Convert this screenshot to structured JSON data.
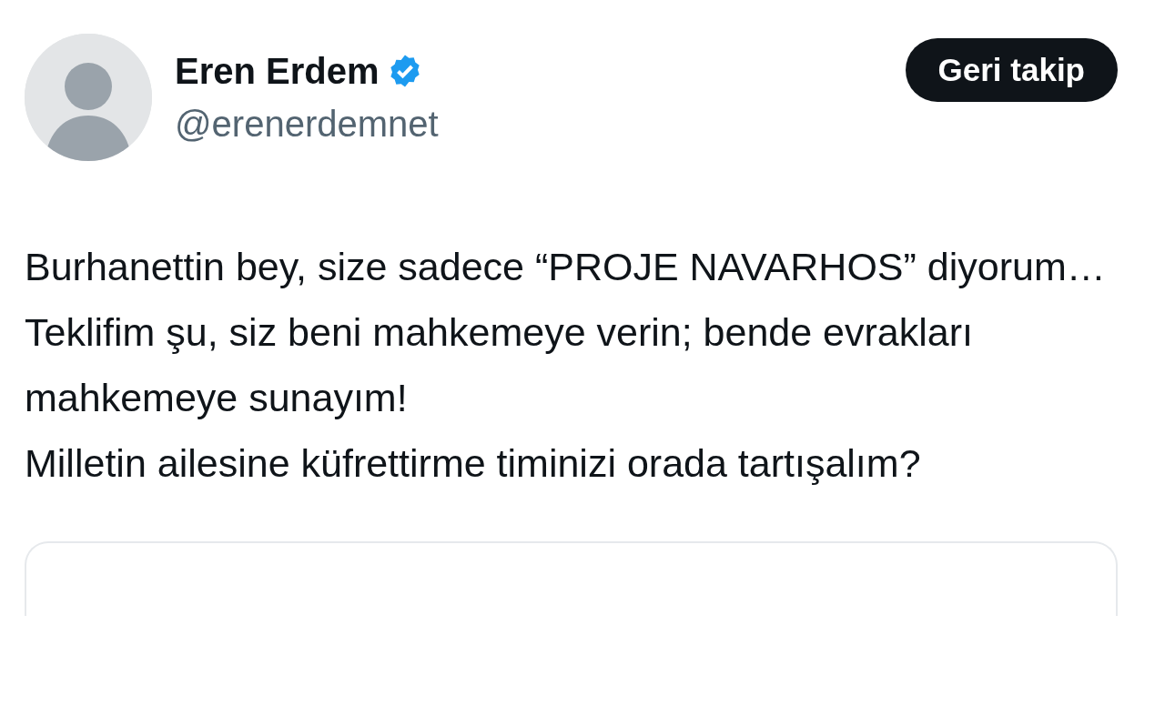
{
  "author": {
    "name": "Eren Erdem",
    "verified": true,
    "handle": "@erenerdemnet"
  },
  "follow_button": {
    "label": "Geri takip"
  },
  "tweet": {
    "paragraphs": [
      "Burhanettin bey, size sadece “PROJE NAVARHOS” diyorum…",
      "Teklifim şu, siz beni mahkemeye verin; bende evrakları mahkemeye sunayım!",
      "Milletin ailesine küfrettirme timinizi orada tartışalım?"
    ]
  }
}
